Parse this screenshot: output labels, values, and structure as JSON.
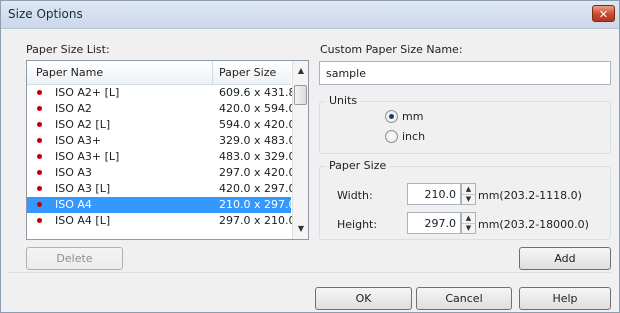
{
  "window": {
    "title": "Size Options",
    "close_glyph": "✕"
  },
  "paper_list": {
    "label": "Paper Size List:",
    "headers": {
      "name": "Paper Name",
      "size": "Paper Size",
      "sort_glyph": "▲"
    },
    "rows": [
      {
        "name": "ISO A2+ [L]",
        "size": "609.6 x 431.8"
      },
      {
        "name": "ISO A2",
        "size": "420.0 x 594.0"
      },
      {
        "name": "ISO A2 [L]",
        "size": "594.0 x 420.0"
      },
      {
        "name": "ISO A3+",
        "size": "329.0 x 483.0"
      },
      {
        "name": "ISO A3+ [L]",
        "size": "483.0 x 329.0"
      },
      {
        "name": "ISO A3",
        "size": "297.0 x 420.0"
      },
      {
        "name": "ISO A3 [L]",
        "size": "420.0 x 297.0"
      },
      {
        "name": "ISO A4",
        "size": "210.0 x 297.0",
        "selected": true
      },
      {
        "name": "ISO A4 [L]",
        "size": "297.0 x 210.0"
      }
    ],
    "scroll": {
      "up_glyph": "▲",
      "down_glyph": "▼"
    }
  },
  "delete_button": "Delete",
  "custom_name": {
    "label": "Custom Paper Size Name:",
    "value": "sample"
  },
  "units": {
    "label": "Units",
    "options": [
      "mm",
      "inch"
    ],
    "selected": "mm"
  },
  "paper_size": {
    "label": "Paper Size",
    "width": {
      "label": "Width:",
      "value": "210.0",
      "range": "mm(203.2-1118.0)"
    },
    "height": {
      "label": "Height:",
      "value": "297.0",
      "range": "mm(203.2-18000.0)"
    }
  },
  "spin": {
    "up_glyph": "▲",
    "down_glyph": "▼"
  },
  "add_button": "Add",
  "buttons": {
    "ok": "OK",
    "cancel": "Cancel",
    "help": "Help"
  },
  "colors": {
    "selection": "#3399ff",
    "bullet": "#c00000",
    "close": "#c94a2f"
  }
}
